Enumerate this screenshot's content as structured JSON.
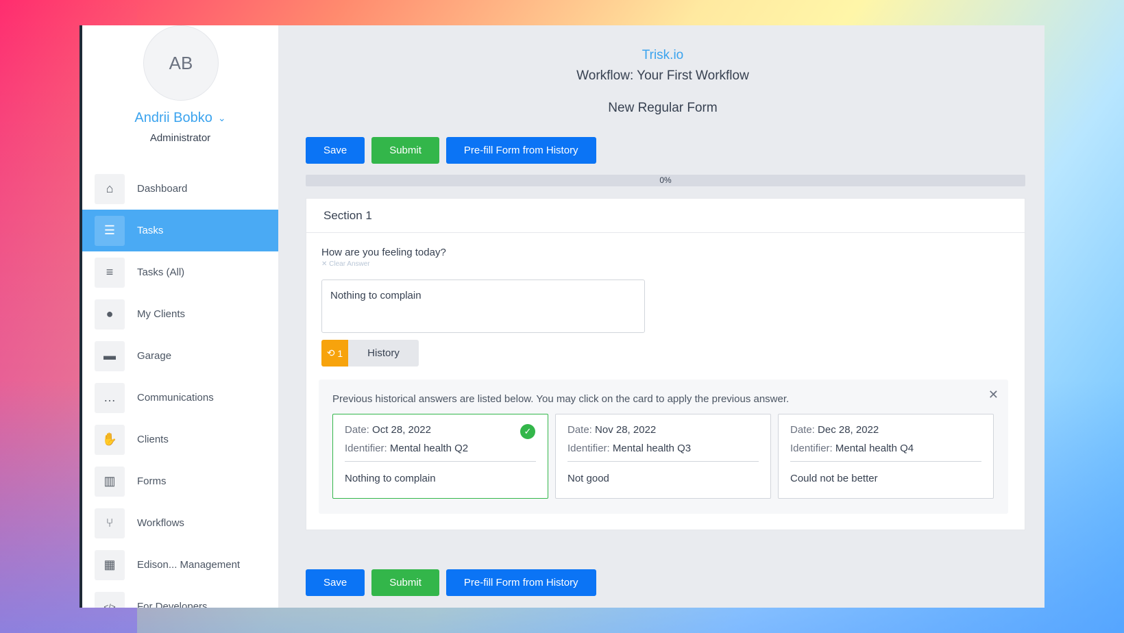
{
  "user": {
    "initials": "AB",
    "name": "Andrii Bobko",
    "role": "Administrator"
  },
  "nav": [
    {
      "label": "Dashboard",
      "icon": "home-icon",
      "glyph": "⌂",
      "active": false
    },
    {
      "label": "Tasks",
      "icon": "tasks-icon",
      "glyph": "☰",
      "active": true
    },
    {
      "label": "Tasks (All)",
      "icon": "list-check-icon",
      "glyph": "≡",
      "active": false
    },
    {
      "label": "My Clients",
      "icon": "user-icon",
      "glyph": "●",
      "active": false
    },
    {
      "label": "Garage",
      "icon": "archive-icon",
      "glyph": "▬",
      "active": false
    },
    {
      "label": "Communications",
      "icon": "chat-icon",
      "glyph": "…",
      "active": false
    },
    {
      "label": "Clients",
      "icon": "handshake-icon",
      "glyph": "✋",
      "active": false
    },
    {
      "label": "Forms",
      "icon": "columns-icon",
      "glyph": "▥",
      "active": false
    },
    {
      "label": "Workflows",
      "icon": "branch-icon",
      "glyph": "⑂",
      "active": false
    },
    {
      "label": "Edison... Management",
      "icon": "building-icon",
      "glyph": "▦",
      "active": false
    },
    {
      "label": "For Developers",
      "icon": "code-icon",
      "glyph": "</>",
      "active": false
    }
  ],
  "header": {
    "brand": "Trisk.io",
    "workflow": "Workflow:  Your First Workflow",
    "form_title": "New Regular Form"
  },
  "buttons": {
    "save": "Save",
    "submit": "Submit",
    "prefill": "Pre-fill Form from History"
  },
  "progress": {
    "value": 0,
    "label": "0%"
  },
  "section": {
    "title": "Section 1",
    "question": "How are you feeling today?",
    "clear_label": "Clear Answer",
    "answer": "Nothing to complain"
  },
  "history": {
    "count": "1",
    "button_label": "History",
    "intro": "Previous historical answers are listed below. You may click on the card to apply the previous answer.",
    "date_key": "Date:",
    "identifier_key": "Identifier:",
    "cards": [
      {
        "date": "Oct 28, 2022",
        "identifier": "Mental health Q2",
        "answer": "Nothing to complain",
        "selected": true
      },
      {
        "date": "Nov 28, 2022",
        "identifier": "Mental health Q3",
        "answer": "Not good",
        "selected": false
      },
      {
        "date": "Dec 28, 2022",
        "identifier": "Mental health Q4",
        "answer": "Could not be better",
        "selected": false
      }
    ]
  },
  "colors": {
    "accent": "#0b74f5",
    "success": "#33b64a",
    "active_nav": "#4aaaf4",
    "warning": "#f7a30c"
  }
}
